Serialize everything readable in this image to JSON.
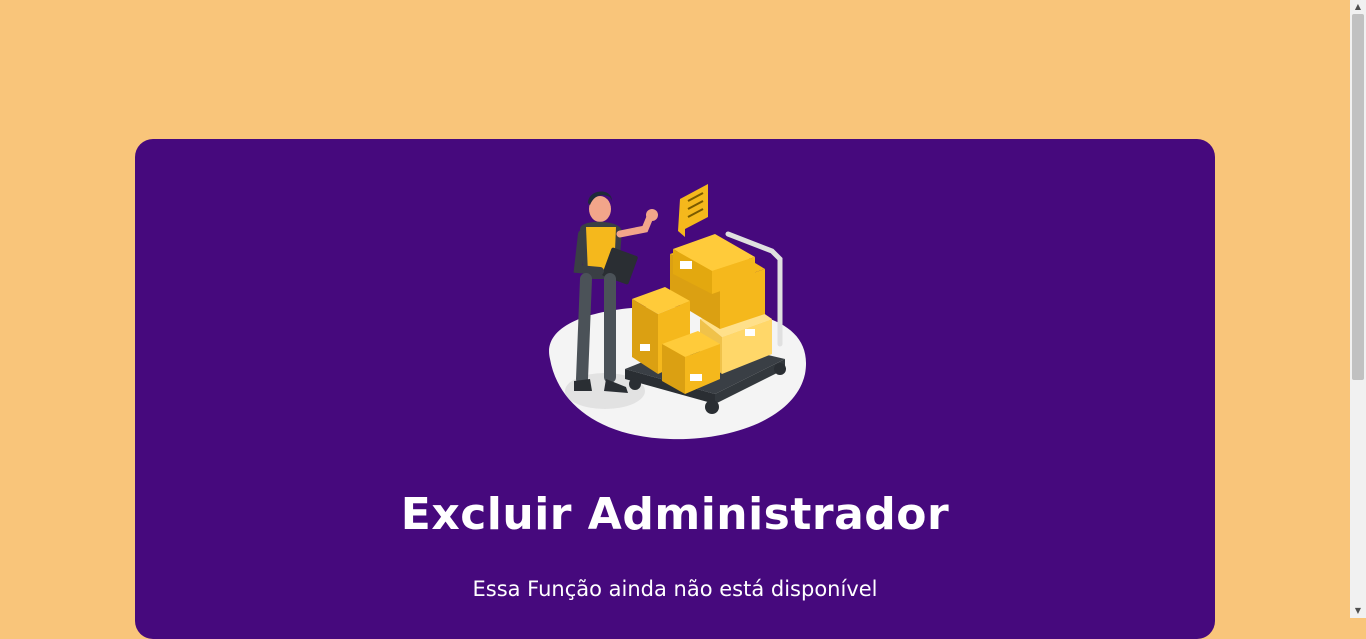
{
  "card": {
    "title": "Excluir Administrador",
    "message": "Essa Função ainda não está disponível"
  },
  "illustration": {
    "icon": "delivery-worker-boxes-illustration"
  },
  "colors": {
    "page_background": "#f9c57a",
    "card_background": "#46097d",
    "text": "#ffffff",
    "box_yellow": "#f5b81c"
  }
}
